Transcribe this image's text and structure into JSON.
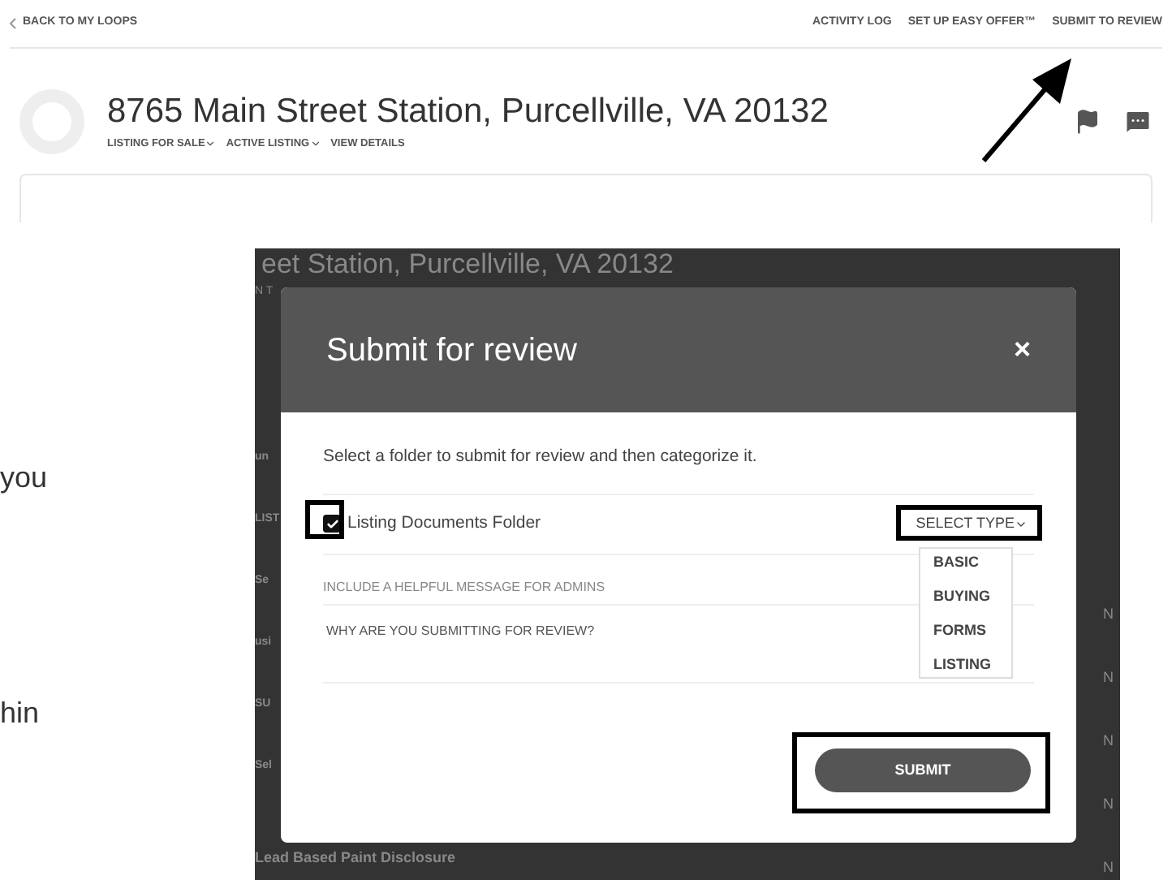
{
  "top_nav": {
    "back_link": "BACK TO MY LOOPS",
    "links": [
      "ACTIVITY LOG",
      "SET UP EASY OFFER™",
      "SUBMIT TO REVIEW"
    ]
  },
  "header": {
    "title": "8765 Main Street Station, Purcellville, VA 20132",
    "menus": [
      {
        "label": "LISTING FOR SALE",
        "kind": "dropdown"
      },
      {
        "label": "ACTIVE LISTING",
        "kind": "dropdown"
      },
      {
        "label": "VIEW DETAILS",
        "kind": "link"
      }
    ]
  },
  "side_text": [
    "you",
    "hin"
  ],
  "inset": {
    "background_title": "eet Station, Purcellville, VA 20132",
    "background_caption": "N T",
    "background_left": [
      "un",
      "LIST",
      "Se",
      "usi",
      "SU",
      "Sel"
    ],
    "background_last": "Lead Based Paint Disclosure",
    "background_right": [
      "N",
      "N",
      "N",
      "N",
      "N"
    ],
    "modal": {
      "title": "Submit for review",
      "close": "×",
      "instruction": "Select a folder to submit for review and then categorize it.",
      "folder": {
        "label": "Listing Documents Folder",
        "checked": true
      },
      "select": {
        "label": "SELECT TYPE",
        "options": [
          "BASIC",
          "BUYING",
          "FORMS",
          "LISTING"
        ]
      },
      "message_label": "INCLUDE A HELPFUL MESSAGE FOR ADMINS",
      "message_placeholder": "WHY ARE YOU SUBMITTING FOR REVIEW?",
      "submit": "SUBMIT"
    }
  }
}
